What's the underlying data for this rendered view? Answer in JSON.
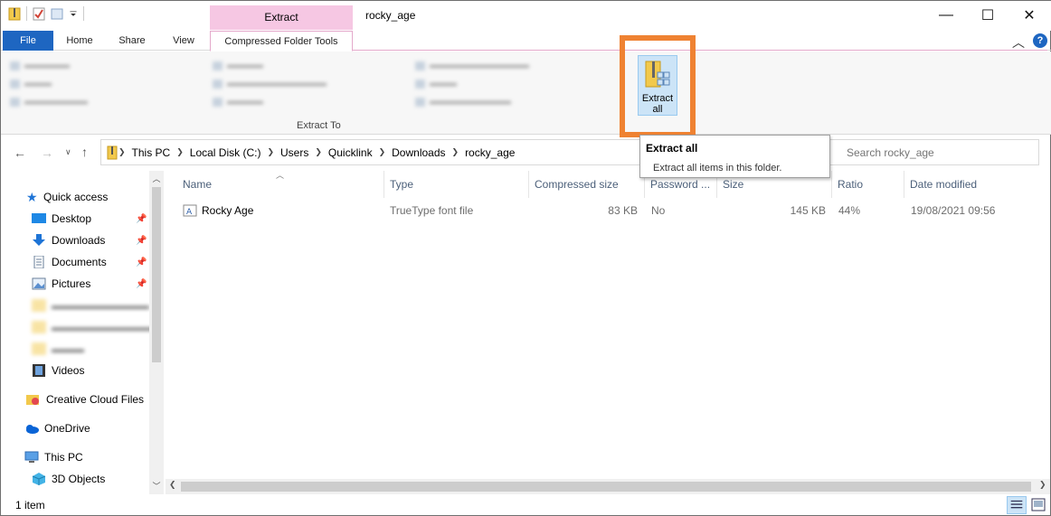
{
  "window": {
    "title": "rocky_age",
    "minimize": "—",
    "maximize": "☐",
    "close": "✕"
  },
  "ribbon": {
    "contextual_group": "Extract",
    "tabs": [
      {
        "label": "File"
      },
      {
        "label": "Home"
      },
      {
        "label": "Share"
      },
      {
        "label": "View"
      },
      {
        "label": "Compressed Folder Tools"
      }
    ],
    "collapse_glyph": "︿",
    "help_glyph": "?",
    "group_label": "Extract To",
    "extract_all_line1": "Extract",
    "extract_all_line2": "all"
  },
  "tooltip": {
    "title": "Extract all",
    "description": "Extract all items in this folder."
  },
  "address": {
    "crumbs": [
      "This PC",
      "Local Disk (C:)",
      "Users",
      "Quicklink",
      "Downloads",
      "rocky_age"
    ]
  },
  "search": {
    "placeholder": "Search rocky_age"
  },
  "nav": {
    "quick_access": "Quick access",
    "items": [
      {
        "label": "Desktop"
      },
      {
        "label": "Downloads"
      },
      {
        "label": "Documents"
      },
      {
        "label": "Pictures"
      },
      {
        "label": "Videos"
      }
    ],
    "creative_cloud": "Creative Cloud Files",
    "onedrive": "OneDrive",
    "this_pc": "This PC",
    "objects_3d": "3D Objects"
  },
  "columns": {
    "name": "Name",
    "type": "Type",
    "compressed_size": "Compressed size",
    "password": "Password ...",
    "size": "Size",
    "ratio": "Ratio",
    "date_modified": "Date modified"
  },
  "files": [
    {
      "name": "Rocky Age",
      "type": "TrueType font file",
      "compressed_size": "83 KB",
      "password": "No",
      "size": "145 KB",
      "ratio": "44%",
      "date_modified": "19/08/2021 09:56"
    }
  ],
  "status": {
    "count": "1 item"
  },
  "colors": {
    "file_tab": "#1e66c1",
    "context_tab": "#f6c7e3",
    "highlight": "#ef8232",
    "header_text": "#4c607a"
  }
}
